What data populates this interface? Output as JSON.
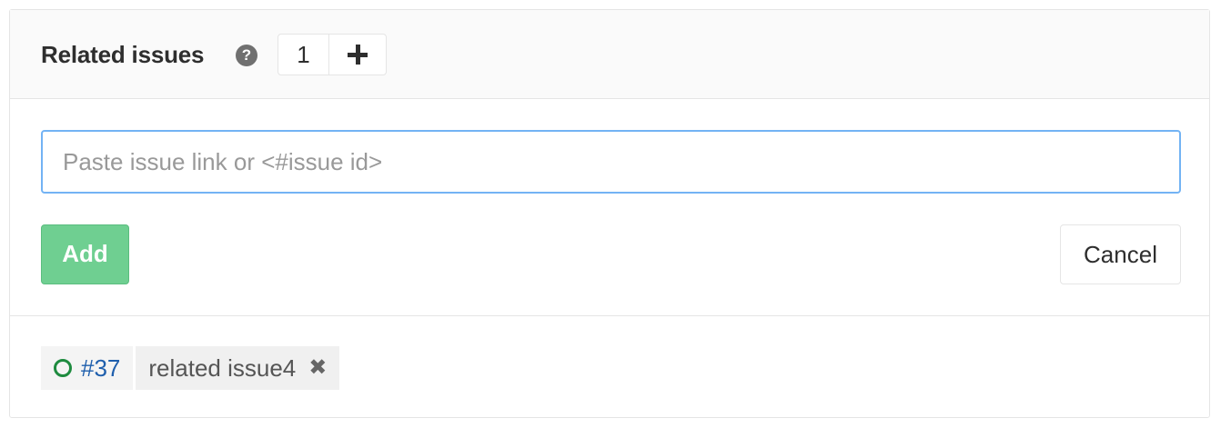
{
  "header": {
    "title": "Related issues",
    "help_icon": "question-circle-icon",
    "count": "1",
    "add_icon": "plus-icon"
  },
  "form": {
    "input_placeholder": "Paste issue link or <#issue id>",
    "input_value": "",
    "add_label": "Add",
    "cancel_label": "Cancel"
  },
  "tokens": [
    {
      "status_icon": "issue-open-icon",
      "reference": "#37",
      "title": "related issue4",
      "remove_icon": "close-icon"
    }
  ],
  "colors": {
    "accent_blue": "#73b3f4",
    "add_button": "#6fcf91",
    "issue_open": "#1e8b3f",
    "link": "#1f5fad"
  }
}
